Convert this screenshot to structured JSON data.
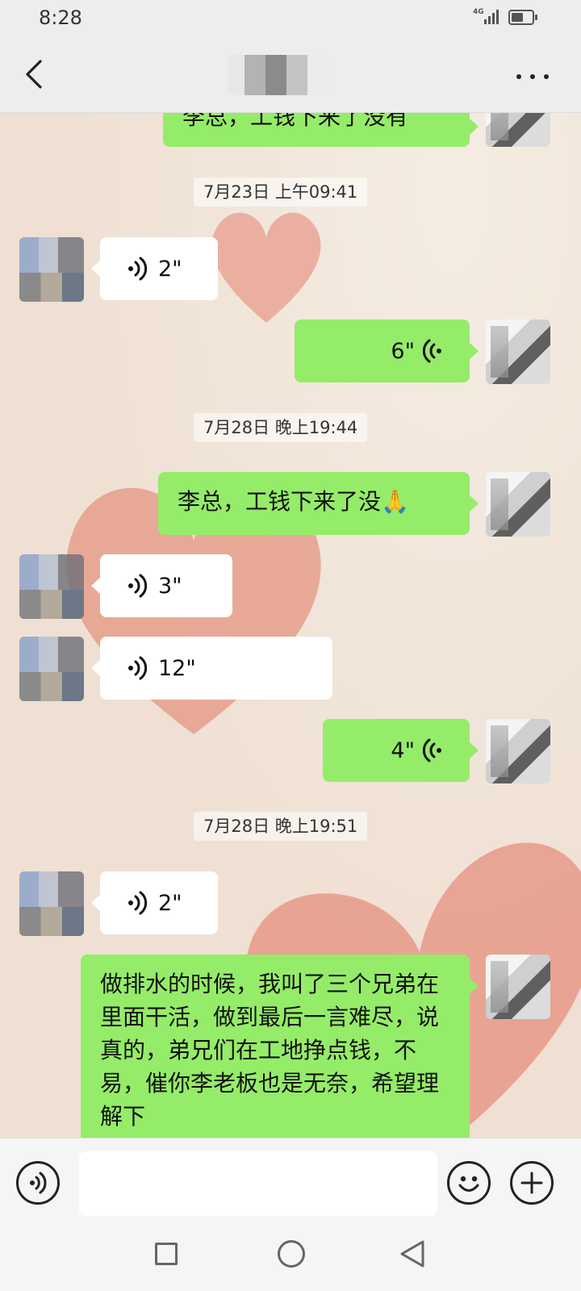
{
  "status_bar": {
    "time": "8:28",
    "network": "4G",
    "battery_level": 0.6
  },
  "nav": {
    "title": ""
  },
  "chat": {
    "timestamps": [
      "7月23日 上午09:41",
      "7月28日 晚上19:44",
      "7月28日 晚上19:51"
    ],
    "messages": [
      {
        "from": "me",
        "type": "text",
        "text": "李总，工钱下来了没有"
      },
      {
        "from": "other",
        "type": "voice",
        "duration": "2\""
      },
      {
        "from": "me",
        "type": "voice",
        "duration": "6\""
      },
      {
        "from": "me",
        "type": "text",
        "text": "李总，工钱下来了没🙏"
      },
      {
        "from": "other",
        "type": "voice",
        "duration": "3\""
      },
      {
        "from": "other",
        "type": "voice",
        "duration": "12\""
      },
      {
        "from": "me",
        "type": "voice",
        "duration": "4\""
      },
      {
        "from": "other",
        "type": "voice",
        "duration": "2\""
      },
      {
        "from": "me",
        "type": "text",
        "text": "做排水的时候，我叫了三个兄弟在里面干活，做到最后一言难尽，说真的，弟兄们在工地挣点钱，不易，催你李老板也是无奈，希望理解下"
      }
    ]
  },
  "icons": {
    "back": "chevron-left-icon",
    "more": "more-dots-icon",
    "voice_in": "voice-wave-icon",
    "voice_out": "voice-wave-icon",
    "voice_toggle": "voice-mode-icon",
    "emoji": "emoji-icon",
    "plus": "plus-icon"
  },
  "colors": {
    "outgoing_bubble": "#95ec69",
    "incoming_bubble": "#ffffff",
    "bar_bg": "#ededed"
  }
}
